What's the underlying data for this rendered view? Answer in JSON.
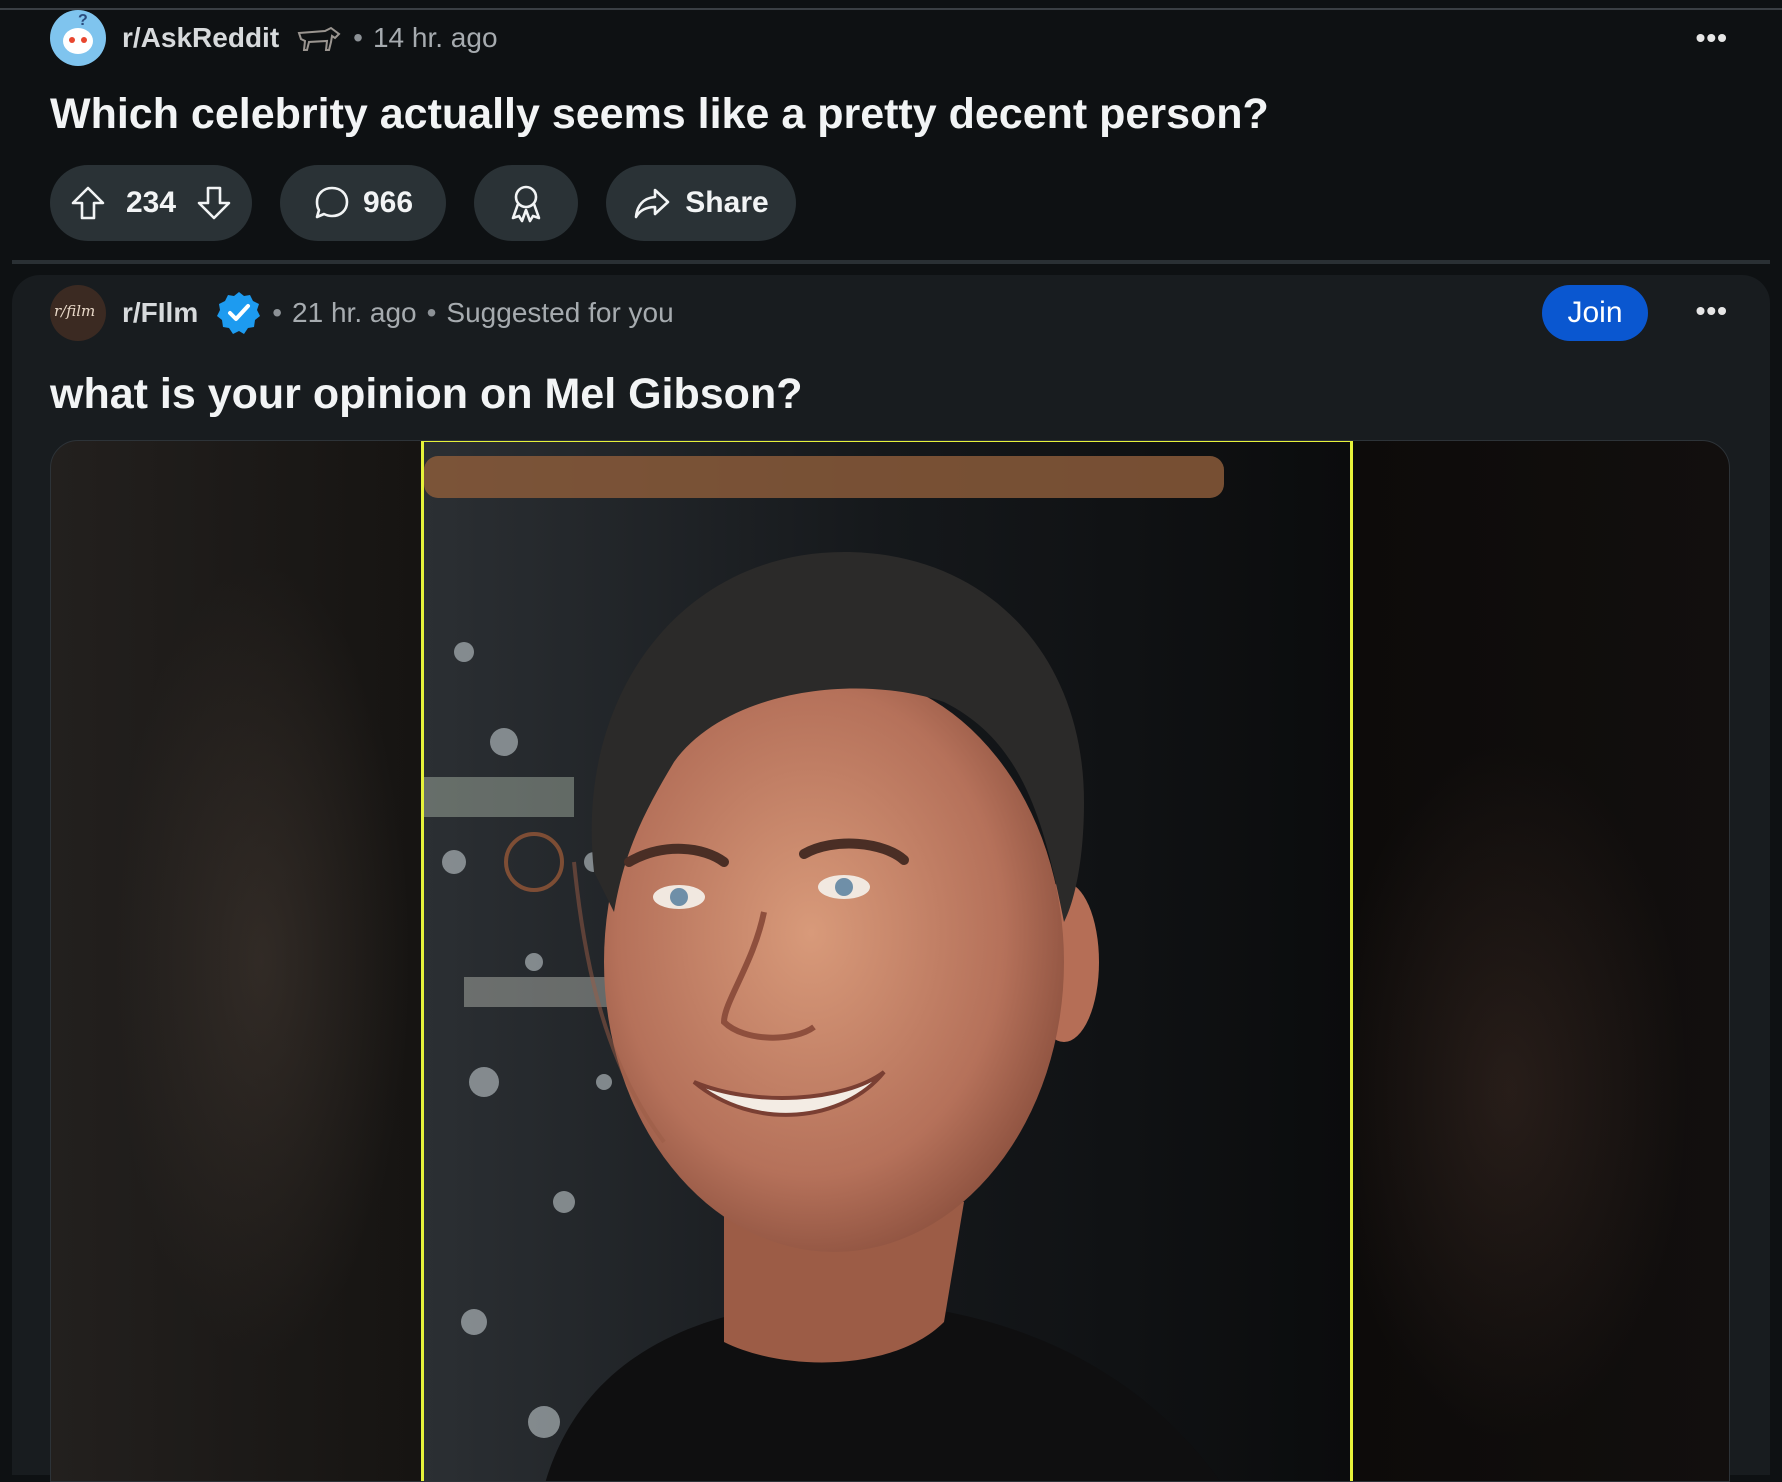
{
  "post1": {
    "subreddit": "r/AskReddit",
    "separator": "•",
    "time": "14 hr. ago",
    "title": "Which celebrity actually seems like a pretty decent person?",
    "votes": "234",
    "comments": "966",
    "share_label": "Share",
    "more_label": "•••"
  },
  "post2": {
    "subreddit": "r/FIlm",
    "avatar_text": "r/film",
    "separator": "•",
    "time": "21 hr. ago",
    "suggested": "Suggested for you",
    "join_label": "Join",
    "more_label": "•••",
    "title": "what is your opinion on Mel Gibson?"
  },
  "colors": {
    "background": "#0e1113",
    "card": "#181c1f",
    "pill": "#2a3236",
    "join": "#0a57d0",
    "verified": "#1d9bf0",
    "image_border": "#e6f23a"
  }
}
